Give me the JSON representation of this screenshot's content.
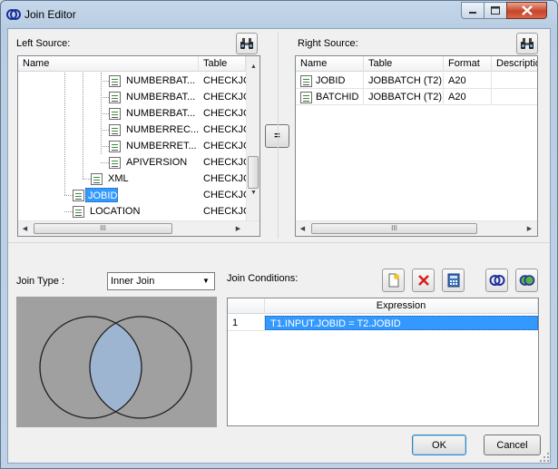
{
  "window": {
    "title": "Join Editor"
  },
  "left_source": {
    "label": "Left Source:",
    "columns": [
      "Name",
      "Table"
    ],
    "rows": [
      {
        "name": "NUMBERBAT...",
        "table": "CHECKJC"
      },
      {
        "name": "NUMBERBAT...",
        "table": "CHECKJC"
      },
      {
        "name": "NUMBERBAT...",
        "table": "CHECKJC"
      },
      {
        "name": "NUMBERREC...",
        "table": "CHECKJC"
      },
      {
        "name": "NUMBERRET...",
        "table": "CHECKJC"
      },
      {
        "name": "APIVERSION",
        "table": "CHECKJC"
      },
      {
        "name": "XML",
        "table": "CHECKJC"
      },
      {
        "name": "JOBID",
        "table": "CHECKJC"
      },
      {
        "name": "LOCATION",
        "table": "CHECKJC"
      }
    ],
    "selected_row": "JOBID",
    "scroll_mark": "III"
  },
  "right_source": {
    "label": "Right Source:",
    "columns": [
      "Name",
      "Table",
      "Format",
      "Description"
    ],
    "rows": [
      {
        "name": "JOBID",
        "table": "JOBBATCH (T2)",
        "format": "A20",
        "description": ""
      },
      {
        "name": "BATCHID",
        "table": "JOBBATCH (T2)",
        "format": "A20",
        "description": ""
      }
    ],
    "scroll_mark": "III"
  },
  "equals_button": "=",
  "join_type": {
    "label": "Join Type :",
    "value": "Inner Join"
  },
  "join_conditions": {
    "label": "Join Conditions:",
    "columns": [
      "",
      "Expression"
    ],
    "rows": [
      {
        "num": "1",
        "expression": "T1.INPUT.JOBID = T2.JOBID"
      }
    ]
  },
  "buttons": {
    "ok": "OK",
    "cancel": "Cancel"
  },
  "colors": {
    "venn_background": "#a0a0a0",
    "venn_intersection": "#9db5d1",
    "selection": "#3399ff"
  },
  "icons": {
    "find": "binoculars-icon",
    "new_condition": "new-document-icon",
    "delete_condition": "red-x-icon",
    "calculator": "calculator-icon",
    "inner_join": "inner-join-icon",
    "outer_join": "outer-join-icon"
  }
}
